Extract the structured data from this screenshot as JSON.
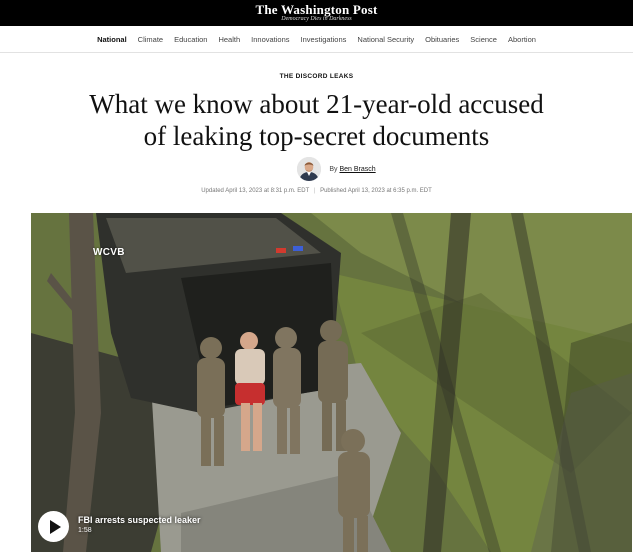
{
  "masthead": {
    "logo": "The Washington Post",
    "tagline": "Democracy Dies in Darkness"
  },
  "nav": {
    "items": [
      {
        "label": "National",
        "active": true
      },
      {
        "label": "Climate"
      },
      {
        "label": "Education"
      },
      {
        "label": "Health"
      },
      {
        "label": "Innovations"
      },
      {
        "label": "Investigations"
      },
      {
        "label": "National Security"
      },
      {
        "label": "Obituaries"
      },
      {
        "label": "Science"
      },
      {
        "label": "Abortion"
      }
    ]
  },
  "article": {
    "kicker": "THE DISCORD LEAKS",
    "headline_line1": "What we know about 21-year-old accused",
    "headline_line2": "of leaking top-secret documents",
    "byline_prefix": "By",
    "author": "Ben Brasch",
    "updated": "Updated April 13, 2023 at 8:31 p.m. EDT",
    "separator": "|",
    "published": "Published April 13, 2023 at 6:35 p.m. EDT"
  },
  "video": {
    "watermark": "WCVB",
    "caption_title": "FBI arrests suspected leaker",
    "duration": "1:58",
    "play_icon": "play-icon"
  }
}
